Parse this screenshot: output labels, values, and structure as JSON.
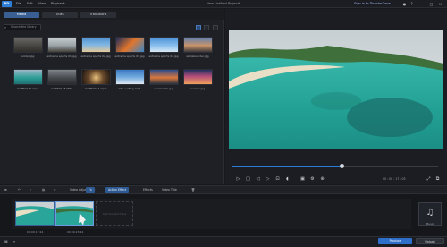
{
  "titlebar": {
    "logo": "PD",
    "menus": [
      "File",
      "Edit",
      "View",
      "Playback"
    ],
    "title": "New Untitled Project*",
    "signin": "Sign in to DirectorZone",
    "icons": [
      "user-icon",
      "help-icon",
      "minimize-icon",
      "maximize-icon",
      "close-icon"
    ]
  },
  "library": {
    "tabs": [
      {
        "label": "Media",
        "active": true
      },
      {
        "label": "Titles",
        "active": false
      },
      {
        "label": "Transitions",
        "active": false
      }
    ],
    "search_placeholder": "Search the library",
    "items": [
      {
        "caption": "bolder.jpg"
      },
      {
        "caption": "extreme sports 01.jpg"
      },
      {
        "caption": "extreme sports 02.jpg"
      },
      {
        "caption": "extreme sports 03.jpg"
      },
      {
        "caption": "extreme sports 04.jpg"
      },
      {
        "caption": "skateboarder.jpg"
      },
      {
        "caption": "GOPR0120.mp4"
      },
      {
        "caption": "GOPR0148.MP4"
      },
      {
        "caption": "GOPR0154.mp4"
      },
      {
        "caption": "kite surfing.mp4"
      },
      {
        "caption": "sunrise 01.jpg"
      },
      {
        "caption": "sunrise.jpg"
      }
    ]
  },
  "preview": {
    "timecode": "00 : 00 : 17 : 03",
    "progress": 0.53
  },
  "toolbar": {
    "tools": [
      "Fix / Enhance",
      "Tools",
      "Video Adjustment",
      "Fx",
      "Action Effect",
      "Effects",
      "Video Title",
      "Delete"
    ],
    "fx_label": "Fx",
    "action_label": "Action Effect"
  },
  "timeline": {
    "clips": [
      {
        "time": "00:00:17:24"
      },
      {
        "time": "00:00:23:24"
      }
    ],
    "drop_hint": "Add Content Here",
    "music_label": "Music"
  },
  "bottombar": {
    "produce": "Produce",
    "upload": "Upload"
  }
}
